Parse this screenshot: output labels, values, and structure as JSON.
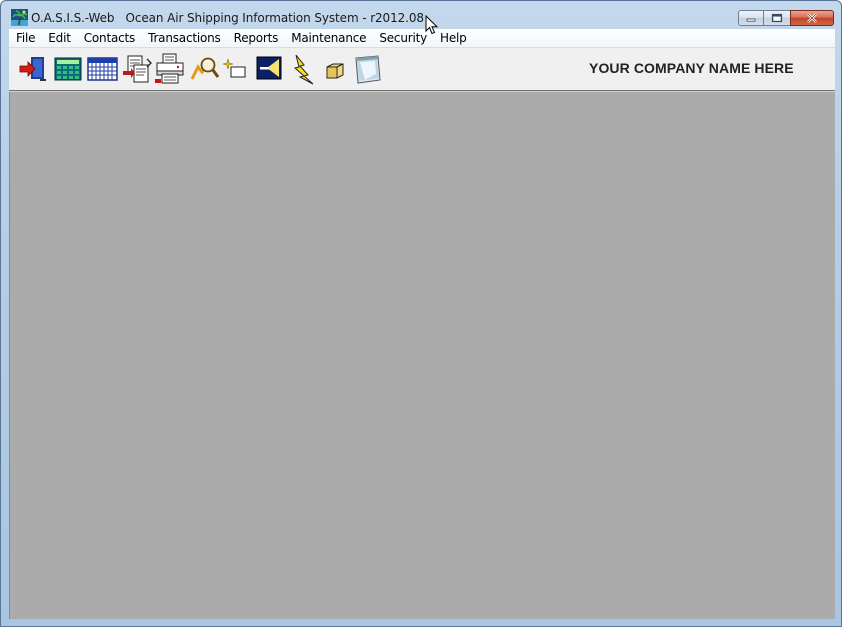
{
  "window": {
    "title": "O.A.S.I.S.-Web   Ocean Air Shipping Information System - r2012.08"
  },
  "menu": [
    {
      "label": "File",
      "name": "menu-file"
    },
    {
      "label": "Edit",
      "name": "menu-edit"
    },
    {
      "label": "Contacts",
      "name": "menu-contacts"
    },
    {
      "label": "Transactions",
      "name": "menu-transactions"
    },
    {
      "label": "Reports",
      "name": "menu-reports"
    },
    {
      "label": "Maintenance",
      "name": "menu-maintenance"
    },
    {
      "label": "Security",
      "name": "menu-security"
    },
    {
      "label": "Help",
      "name": "menu-help"
    }
  ],
  "toolbar": {
    "company_name": "YOUR COMPANY NAME HERE",
    "icons": [
      "exit-door-icon",
      "calculator-icon",
      "calendar-icon",
      "document-transfer-icon",
      "printer-icon",
      "search-magnifier-icon",
      "new-item-icon",
      "gateway-icon",
      "lightning-icon",
      "package-icon",
      "notepad-icon"
    ]
  },
  "colors": {
    "client_background": "#ababab",
    "titlebar": "#b7cfe6",
    "toolbar": "#f0f0f0"
  }
}
